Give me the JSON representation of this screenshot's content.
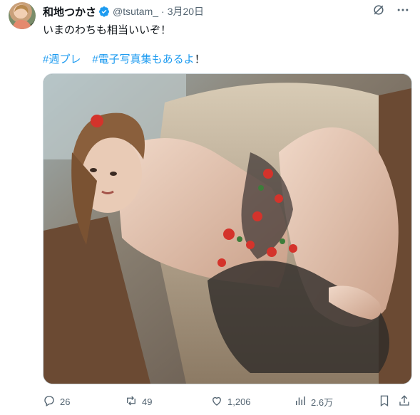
{
  "tweet": {
    "display_name": "和地つかさ",
    "handle": "@tsutam_",
    "separator": "·",
    "date": "3月20日",
    "text": "いまのわちも相当いいぞ！",
    "hashtags": [
      "#週プレ",
      "#電子写真集もあるよ"
    ],
    "trailing": "！"
  },
  "actions": {
    "replies": "26",
    "reposts": "49",
    "likes": "1,206",
    "views": "2.6万"
  },
  "icons": {
    "verified": "verified-badge-icon",
    "grok": "grok-icon",
    "more": "more-icon",
    "reply": "reply-icon",
    "repost": "repost-icon",
    "like": "like-icon",
    "views": "views-icon",
    "bookmark": "bookmark-icon",
    "share": "share-icon"
  },
  "colors": {
    "accent": "#1d9bf0",
    "secondary_text": "#536471",
    "primary_text": "#0f1419"
  }
}
